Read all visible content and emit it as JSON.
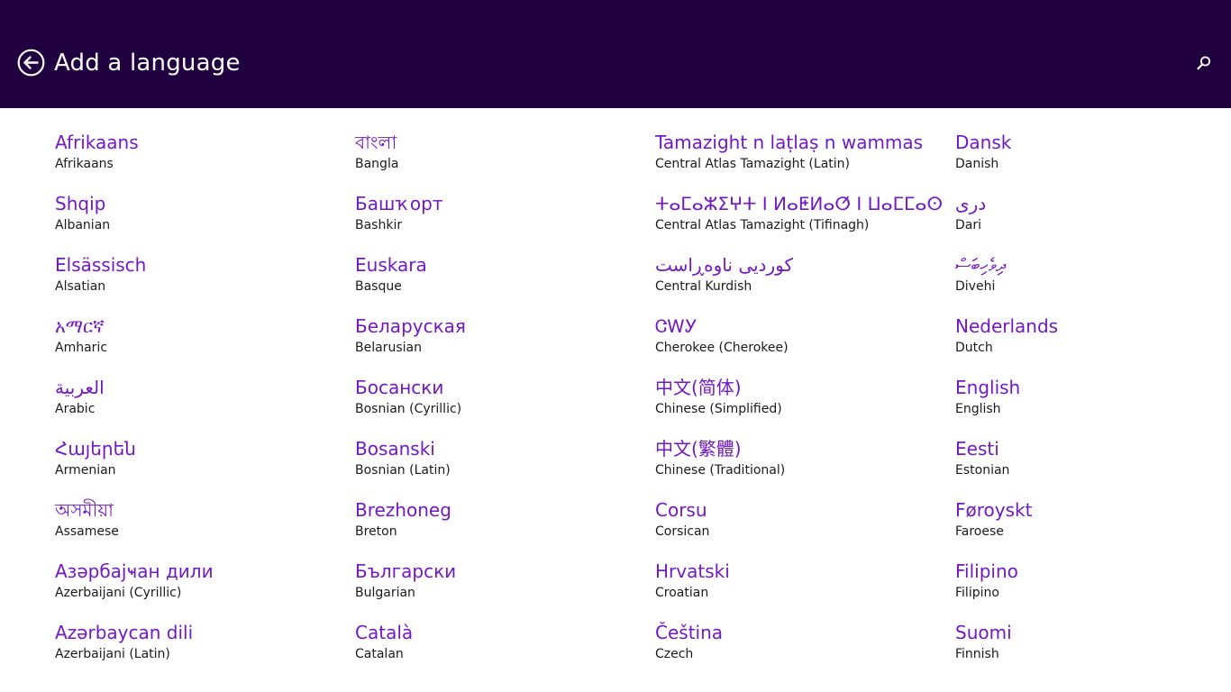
{
  "header": {
    "title": "Add a language",
    "back_icon": "back-arrow-circle-icon",
    "search_icon": "search-icon",
    "background": "#20003f"
  },
  "accent_color": "#7219c0",
  "columns": [
    [
      {
        "native": "Afrikaans",
        "english": "Afrikaans"
      },
      {
        "native": "Shqip",
        "english": "Albanian"
      },
      {
        "native": "Elsässisch",
        "english": "Alsatian"
      },
      {
        "native": "አማርኛ",
        "english": "Amharic"
      },
      {
        "native": "العربية",
        "english": "Arabic"
      },
      {
        "native": "Հայերեն",
        "english": "Armenian"
      },
      {
        "native": "অসমীয়া",
        "english": "Assamese"
      },
      {
        "native": "Азәрбајҹан дили",
        "english": "Azerbaijani (Cyrillic)"
      },
      {
        "native": "Azərbaycan dili",
        "english": "Azerbaijani (Latin)"
      }
    ],
    [
      {
        "native": "বাংলা",
        "english": "Bangla"
      },
      {
        "native": "Башҡорт",
        "english": "Bashkir"
      },
      {
        "native": "Euskara",
        "english": "Basque"
      },
      {
        "native": "Беларуская",
        "english": "Belarusian"
      },
      {
        "native": "Босански",
        "english": "Bosnian (Cyrillic)"
      },
      {
        "native": "Bosanski",
        "english": "Bosnian (Latin)"
      },
      {
        "native": "Brezhoneg",
        "english": "Breton"
      },
      {
        "native": "Български",
        "english": "Bulgarian"
      },
      {
        "native": "Català",
        "english": "Catalan"
      }
    ],
    [
      {
        "native": "Tamazight n laṭlaṣ n wammas",
        "english": "Central Atlas Tamazight (Latin)"
      },
      {
        "native": "ⵜⴰⵎⴰⵣⵉⵖⵜ ⵏ ⵍⴰⵟⵍⴰⵚ ⵏ ⵡⴰⵎⵎⴰⵙ",
        "english": "Central Atlas Tamazight (Tifinagh)"
      },
      {
        "native": "کوردیی ناوەڕاست",
        "english": "Central Kurdish"
      },
      {
        "native": "ᏣᎳᎩ",
        "english": "Cherokee (Cherokee)"
      },
      {
        "native": "中文(简体)",
        "english": "Chinese (Simplified)"
      },
      {
        "native": "中文(繁體)",
        "english": "Chinese (Traditional)"
      },
      {
        "native": "Corsu",
        "english": "Corsican"
      },
      {
        "native": "Hrvatski",
        "english": "Croatian"
      },
      {
        "native": "Čeština",
        "english": "Czech"
      }
    ],
    [
      {
        "native": "Dansk",
        "english": "Danish"
      },
      {
        "native": "دری",
        "english": "Dari"
      },
      {
        "native": "ދިވެހިބަސް",
        "english": "Divehi"
      },
      {
        "native": "Nederlands",
        "english": "Dutch"
      },
      {
        "native": "English",
        "english": "English"
      },
      {
        "native": "Eesti",
        "english": "Estonian"
      },
      {
        "native": "Føroyskt",
        "english": "Faroese"
      },
      {
        "native": "Filipino",
        "english": "Filipino"
      },
      {
        "native": "Suomi",
        "english": "Finnish"
      }
    ]
  ]
}
